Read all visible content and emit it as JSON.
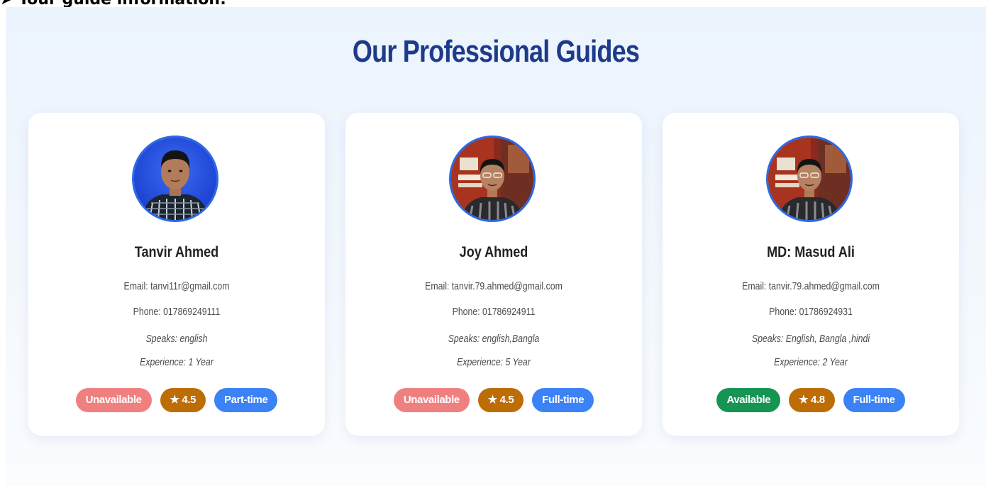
{
  "caption": "➤ Tour guide information:",
  "title": "Our Professional Guides",
  "colors": {
    "title": "#1e3a8a",
    "available": "#169454",
    "unavailable": "#f08080",
    "rating": "#bd6d06",
    "employment": "#3b82f6",
    "avatar_border": "#2d68e6"
  },
  "guides": [
    {
      "name": "Tanvir Ahmed",
      "email": "Email: tanvi11r@gmail.com",
      "phone": "Phone: 017869249111",
      "speaks": "Speaks: english",
      "experience": "Experience: 1 Year",
      "status": "Unavailable",
      "rating": "★ 4.5",
      "employment": "Part-time",
      "photo": "portrait-blue-background"
    },
    {
      "name": "Joy Ahmed",
      "email": "Email: tanvir.79.ahmed@gmail.com",
      "phone": "Phone: 01786924911",
      "speaks": "Speaks: english,Bangla",
      "experience": "Experience: 5 Year",
      "status": "Unavailable",
      "rating": "★ 4.5",
      "employment": "Full-time",
      "photo": "portrait-red-background"
    },
    {
      "name": "MD: Masud Ali",
      "email": "Email: tanvir.79.ahmed@gmail.com",
      "phone": "Phone: 01786924931",
      "speaks": "Speaks: English, Bangla ,hindi",
      "experience": "Experience: 2 Year",
      "status": "Available",
      "rating": "★ 4.8",
      "employment": "Full-time",
      "photo": "portrait-red-background"
    }
  ]
}
